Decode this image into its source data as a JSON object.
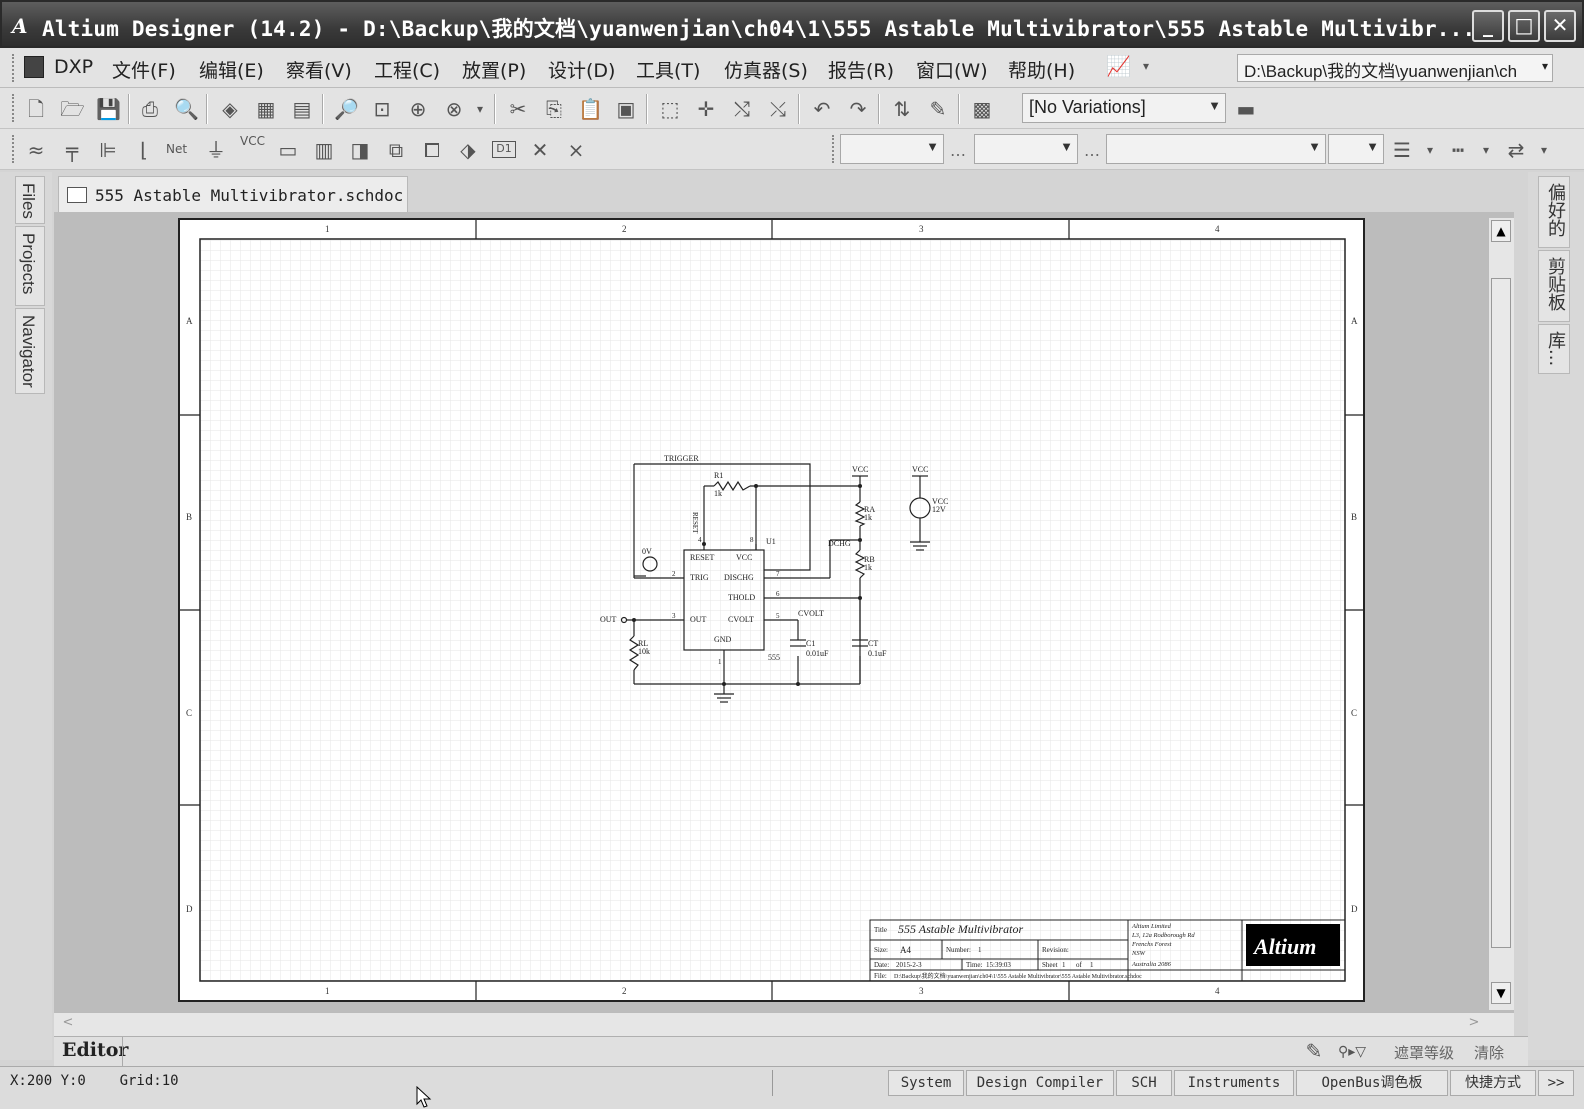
{
  "window": {
    "app_icon": "altium-logo-icon",
    "title": "Altium Designer (14.2) - D:\\Backup\\我的文档\\yuanwenjian\\ch04\\1\\555 Astable Multivibrator\\555 Astable Multivibr...",
    "controls": [
      "minimize-icon",
      "maximize-icon",
      "close-icon"
    ]
  },
  "menubar": {
    "items": [
      "DXP",
      "文件(F)",
      "编辑(E)",
      "察看(V)",
      "工程(C)",
      "放置(P)",
      "设计(D)",
      "工具(T)",
      "仿真器(S)",
      "报告(R)",
      "窗口(W)",
      "帮助(H)"
    ],
    "path": "D:\\Backup\\我的文档\\yuanwenjian\\ch"
  },
  "toolbar1": {
    "variations": "[No Variations]"
  },
  "toolbar2": {
    "net_label": "Net",
    "vcc_label": "VCC",
    "d1_label": "D1"
  },
  "left_panel": {
    "tabs": [
      "Files",
      "Projects",
      "Navigator"
    ]
  },
  "right_panel": {
    "tabs": [
      "偏好的",
      "剪贴板",
      "库..."
    ]
  },
  "document": {
    "tab_name": "555 Astable Multivibrator.schdoc"
  },
  "sheet": {
    "zone_columns": [
      "1",
      "2",
      "3",
      "4"
    ],
    "zone_rows": [
      "A",
      "B",
      "C",
      "D"
    ],
    "schematic": {
      "trigger": "TRIGGER",
      "r1": "R1",
      "r1_value": "1k",
      "reset": "RESET",
      "u1": "U1",
      "vcc_pin": "VCC",
      "ic_reset": "RESET",
      "ic_vcc": "VCC",
      "ic_trig": "TRIG",
      "ic_discharge": "DISCHG",
      "ic_thold": "THOLD",
      "ic_out": "OUT",
      "ic_cvolt": "CVOLT",
      "ic_gnd": "GND",
      "ic_part": "555",
      "pin4": "4",
      "pin8": "8",
      "pin2": "2",
      "pin7": "7",
      "pin6": "6",
      "pin3": "3",
      "pin5": "5",
      "pin1": "1",
      "source_value": "0V",
      "dchg": "DCHG",
      "cvolt": "CVOLT",
      "out": "OUT",
      "rl": "RL",
      "rl_value": "10k",
      "c1": "C1",
      "c1_value": "0.01uF",
      "ct": "CT",
      "ct_value": "0.1uF",
      "ra": "RA",
      "ra_value": "1k",
      "rb": "RB",
      "rb_value": "1k",
      "vcc_top": "VCC",
      "vcc_supply": "VCC",
      "vcc_src": "VCC",
      "vcc_src_value": "12V"
    },
    "title_block": {
      "title_label": "Title",
      "title": "555 Astable Multivibrator",
      "size_label": "Size:",
      "size": "A4",
      "number_label": "Number:",
      "number": "1",
      "revision_label": "Revision:",
      "date_label": "Date:",
      "date": "2015-2-3",
      "time_label": "Time:",
      "time": "15:39:03",
      "sheet_label": "Sheet",
      "sheet_of": "of",
      "sheet_num": "1",
      "sheet_total": "1",
      "file_label": "File:",
      "file": "D:\\Backup\\我的文档\\yuanwenjian\\ch04\\1\\555 Astable Multivibrator\\555 Astable Multivibrator.schdoc",
      "company": [
        "Altium Limited",
        "L3, 12a Rodborough Rd",
        "Frenchs Forest",
        "NSW",
        "Australia 2086"
      ],
      "logo": "Altium"
    }
  },
  "editor_footer": {
    "label": "Editor",
    "mask": "遮罩等级",
    "clear": "清除"
  },
  "statusbar": {
    "coords": "X:200 Y:0    Grid:10",
    "buttons": [
      "System",
      "Design Compiler",
      "SCH",
      "Instruments",
      "OpenBus调色板",
      "快捷方式"
    ],
    "more": ">>"
  }
}
